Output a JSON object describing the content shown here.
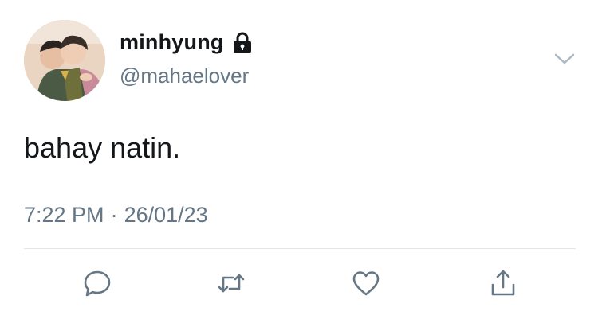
{
  "user": {
    "display_name": "minhyung",
    "handle": "@mahaelover",
    "protected_icon": "lock-icon",
    "avatar_icon": "profile-photo"
  },
  "tweet": {
    "text": "bahay natin.",
    "time": "7:22 PM",
    "separator": "·",
    "date": "26/01/23"
  },
  "actions": [
    {
      "name": "reply",
      "icon": "speech-bubble-icon"
    },
    {
      "name": "retweet",
      "icon": "retweet-arrows-icon"
    },
    {
      "name": "like",
      "icon": "heart-icon"
    },
    {
      "name": "share",
      "icon": "share-up-arrow-icon"
    }
  ],
  "colors": {
    "text": "#14171a",
    "secondary": "#657786",
    "icon": "#657786",
    "divider": "#e1e8ed"
  }
}
